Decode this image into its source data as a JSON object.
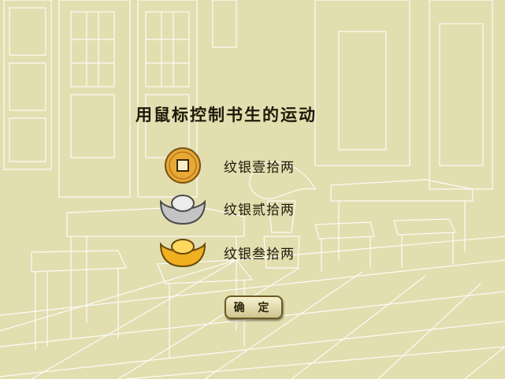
{
  "title": "用鼠标控制书生的运动",
  "options": [
    {
      "label": "纹银壹拾两",
      "icon": "copper-coin-icon"
    },
    {
      "label": "纹银贰拾两",
      "icon": "silver-ingot-icon"
    },
    {
      "label": "纹银叁拾两",
      "icon": "gold-ingot-icon"
    }
  ],
  "confirm_label": "确 定",
  "colors": {
    "background": "#e2deb0",
    "line": "#ffffff",
    "coin": "#e8a836",
    "silver": "#c4c4c4",
    "gold": "#f0b020"
  }
}
